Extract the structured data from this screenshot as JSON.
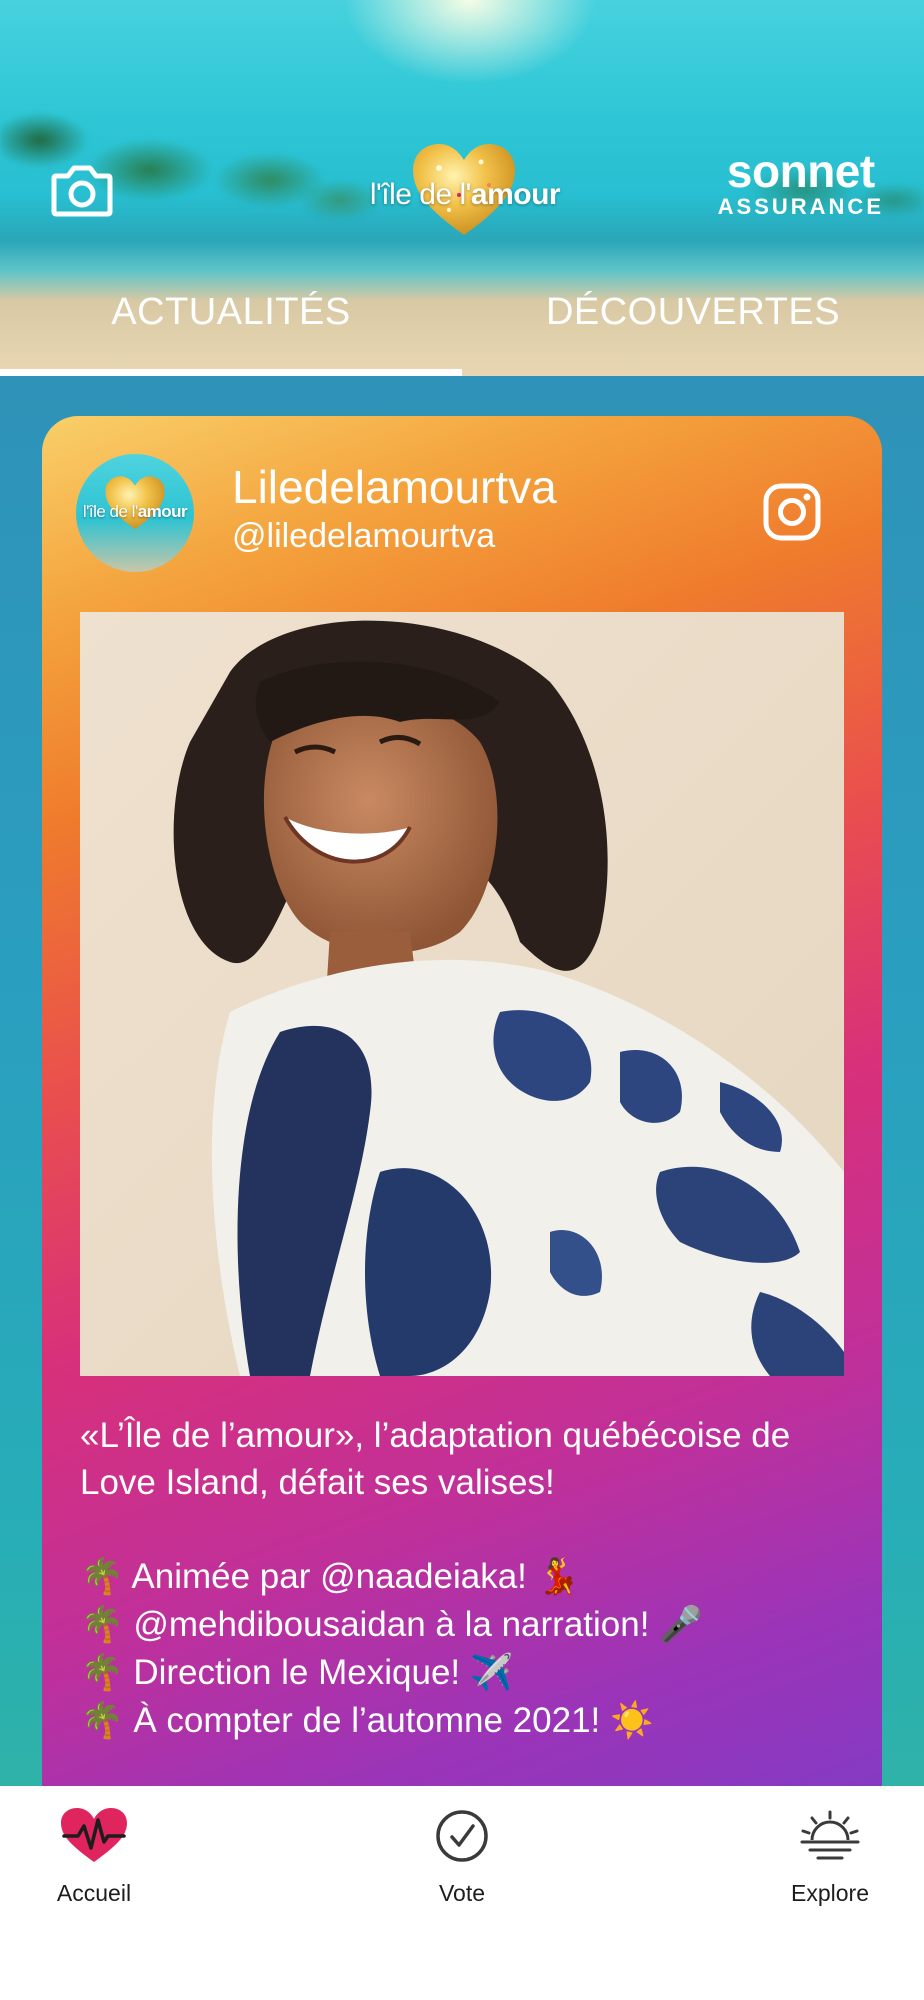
{
  "header": {
    "logo_text_light": "l'île de l'",
    "logo_text_bold": "amour",
    "sponsor_name": "sonnet",
    "sponsor_sub": "ASSURANCE",
    "tabs": [
      {
        "label": "ACTUALITÉS",
        "active": true
      },
      {
        "label": "DÉCOUVERTES",
        "active": false
      }
    ]
  },
  "post": {
    "account_name": "Liledelamourtva",
    "account_handle": "@liledelamourtva",
    "avatar_text_light": "l'île de l'",
    "avatar_text_bold": "amour",
    "caption": {
      "line1": "«L’Île de l’amour», l’adaptation québécoise de",
      "line2": "Love Island, défait ses valises!",
      "bullets": [
        {
          "icon": "🌴",
          "text": " Animée par @naadeiaka! ",
          "emoji": "💃"
        },
        {
          "icon": "🌴",
          "text": " @mehdibousaidan à la narration! ",
          "emoji": "🎤"
        },
        {
          "icon": "🌴",
          "text": " Direction le Mexique! ",
          "emoji": "✈️"
        },
        {
          "icon": "🌴",
          "text": " À compter de l’automne 2021! ",
          "emoji": "☀️"
        }
      ]
    }
  },
  "nav": {
    "items": [
      {
        "label": "Accueil",
        "icon": "heart-pulse-icon",
        "color": "#e0245e"
      },
      {
        "label": "Vote",
        "icon": "check-circle-icon"
      },
      {
        "label": "Explore",
        "icon": "sunset-icon"
      }
    ]
  },
  "colors": {
    "accent_heart": "#e0245e",
    "feed_bg": "#2a9fbf"
  }
}
